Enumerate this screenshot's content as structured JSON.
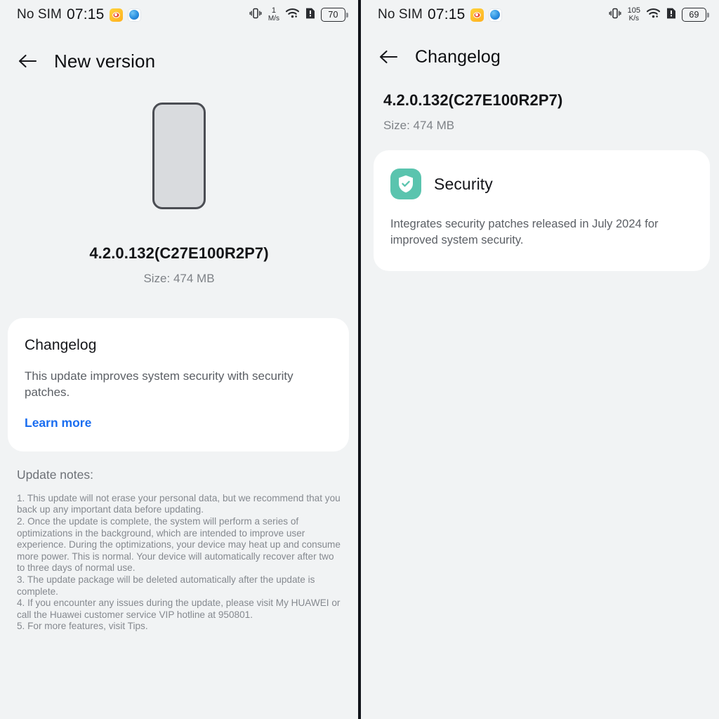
{
  "colors": {
    "background": "#f1f3f4",
    "card": "#ffffff",
    "link_accent": "#1a6df0",
    "security_icon_bg": "#5ac4ae",
    "divider": "#101319",
    "phone_outline": "#4b4d53",
    "phone_fill": "#d9dbde"
  },
  "left_panel": {
    "status_bar": {
      "carrier": "No SIM",
      "clock": "07:15",
      "app_icons": [
        "weibo-notification-icon",
        "browser-notification-icon"
      ],
      "vibrate_icon": "vibrate-icon",
      "network_speed_value": "1",
      "network_speed_unit": "M/s",
      "wifi_icon": "wifi-icon",
      "sim_alert_icon": "sim-alert-icon",
      "battery_level": "70"
    },
    "nav": {
      "back_icon": "back-arrow-icon",
      "title": "New version"
    },
    "hero": {
      "device_illustration": "phone-device-illustration",
      "version": "4.2.0.132(C27E100R2P7)",
      "size": "Size: 474 MB"
    },
    "changelog_card": {
      "title": "Changelog",
      "summary": "This update improves system security with security patches.",
      "link_label": "Learn more"
    },
    "update_notes": {
      "title": "Update notes:",
      "body": "1. This update will not erase your personal data, but we recommend that you back up any important data before updating.\n2. Once the update is complete, the system will perform a series of optimizations in the background, which are intended to improve user experience. During the optimizations, your device may heat up and consume more power. This is normal. Your device will automatically recover after two to three days of normal use.\n3. The update package will be deleted automatically after the update is complete.\n4. If you encounter any issues during the update, please visit My HUAWEI or call the Huawei customer service VIP hotline at 950801.\n5. For more features, visit Tips."
    }
  },
  "right_panel": {
    "status_bar": {
      "carrier": "No SIM",
      "clock": "07:15",
      "app_icons": [
        "weibo-notification-icon",
        "browser-notification-icon"
      ],
      "vibrate_icon": "vibrate-icon",
      "network_speed_value": "105",
      "network_speed_unit": "K/s",
      "wifi_icon": "wifi-icon",
      "sim_alert_icon": "sim-alert-icon",
      "battery_level": "69"
    },
    "nav": {
      "back_icon": "back-arrow-icon",
      "title": "Changelog"
    },
    "version": "4.2.0.132(C27E100R2P7)",
    "size": "Size: 474 MB",
    "feature_card": {
      "icon": "shield-check-icon",
      "name": "Security",
      "description": "Integrates security patches released in July 2024 for improved system security."
    }
  }
}
